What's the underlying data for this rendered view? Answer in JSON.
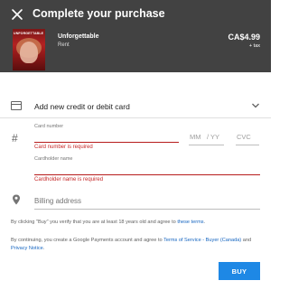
{
  "header": {
    "title": "Complete your purchase",
    "close_icon": "close-icon"
  },
  "product": {
    "poster_text": "UNFORGETTABLE",
    "name": "Unforgettable",
    "type": "Rent",
    "price": "CA$4.99",
    "tax": "+ tax"
  },
  "payment": {
    "method_label": "Add new credit or debit card",
    "card_number_label": "Card number",
    "card_number_error": "Card number is required",
    "mm_placeholder": "MM",
    "yy_placeholder": "/ YY",
    "cvc_placeholder": "CVC",
    "cardholder_label": "Cardholder name",
    "cardholder_error": "Cardholder name is required",
    "billing_label": "Billing address"
  },
  "legal": {
    "line1_prefix": "By clicking \"Buy\" you verify that you are at least 18 years old and agree to ",
    "line1_link": "these terms",
    "line1_suffix": ".",
    "line2_prefix": "By continuing, you create a Google Payments account and agree to ",
    "line2_link1": "Terms of Service - Buyer (Canada)",
    "line2_mid": " and ",
    "line2_link2": "Privacy Notice",
    "line2_suffix": "."
  },
  "actions": {
    "buy_label": "BUY"
  },
  "colors": {
    "header_bg": "#424242",
    "error": "#c62828",
    "accent": "#1e88e5"
  }
}
